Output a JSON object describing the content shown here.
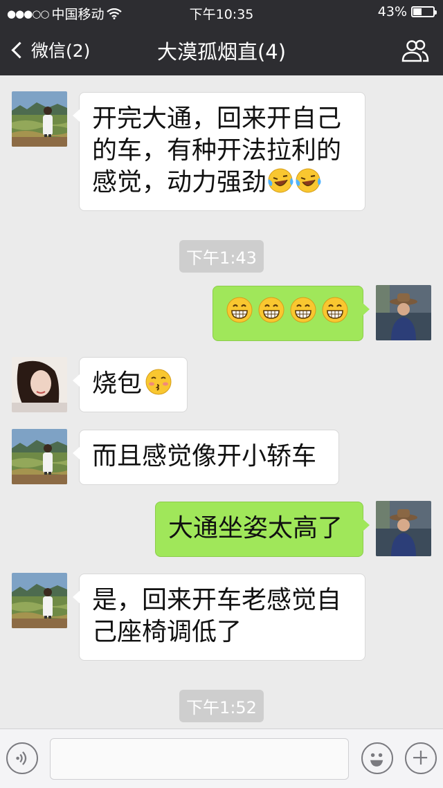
{
  "status": {
    "carrier": "中国移动",
    "signal_dots": "●●●○○",
    "time": "下午10:35",
    "battery": "43%"
  },
  "nav": {
    "back_label": "微信(2)",
    "title": "大漠孤烟直(4)"
  },
  "messages": [
    {
      "side": "in",
      "sender": "man-landscape",
      "text": "开完大通，回来开自己的车，有种开法拉利的感觉，动力强劲",
      "emojis": [
        "crying-laughing",
        "crying-laughing"
      ]
    },
    {
      "type": "time",
      "text": "下午1:43"
    },
    {
      "side": "out",
      "sender": "me",
      "text": "",
      "emojis": [
        "grinning",
        "grinning",
        "grinning",
        "grinning"
      ]
    },
    {
      "side": "in",
      "sender": "woman",
      "text": "烧包",
      "emojis": [
        "kissing"
      ]
    },
    {
      "side": "in",
      "sender": "man-landscape",
      "text": "而且感觉像开小轿车"
    },
    {
      "side": "out",
      "sender": "me",
      "text": "大通坐姿太高了"
    },
    {
      "side": "in",
      "sender": "man-landscape",
      "text": "是，回来开车老感觉自己座椅调低了"
    },
    {
      "type": "time",
      "text": "下午1:52"
    }
  ],
  "m1_line1": "开完大通，回来开自己",
  "m1_line2": "的车，有种开法拉利的",
  "m1_line3": "感觉，动力强劲",
  "m3_text": "烧包",
  "m4_text": "而且感觉像开小轿车",
  "m5_text": "大通坐姿太高了",
  "m6_line1": "是，回来开车老感觉自",
  "m6_line2": "己座椅调低了",
  "time1": "下午1:43",
  "time2": "下午1:52",
  "input": {
    "placeholder": "",
    "icons": [
      "voice-icon",
      "emoji-icon",
      "plus-icon"
    ]
  },
  "colors": {
    "nav_bg": "#2d2d31",
    "chat_bg": "#ebebeb",
    "bubble_out": "#a0e75a",
    "bubble_in": "#ffffff"
  }
}
